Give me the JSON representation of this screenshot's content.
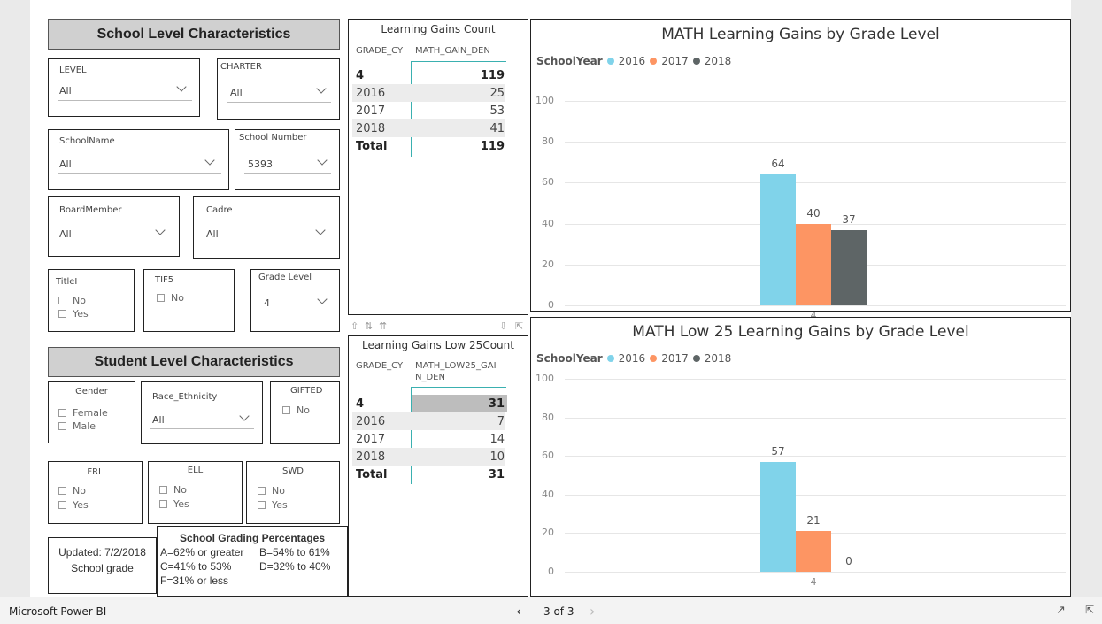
{
  "colors": {
    "y2016": "#80d3ea",
    "y2017": "#fd9563",
    "y2018": "#5e6566"
  },
  "school_header": "School Level Characteristics",
  "student_header": "Student Level Characteristics",
  "filters": {
    "level": {
      "label": "LEVEL",
      "value": "All"
    },
    "charter": {
      "label": "CHARTER",
      "value": "All"
    },
    "school_name": {
      "label": "SchoolName",
      "value": "All"
    },
    "school_number": {
      "label": "School Number",
      "value": "5393"
    },
    "board_member": {
      "label": "BoardMember",
      "value": "All"
    },
    "cadre": {
      "label": "Cadre",
      "value": "All"
    },
    "titlei": {
      "label": "TitleI",
      "options": [
        "No",
        "Yes"
      ]
    },
    "tif5": {
      "label": "TIF5",
      "options": [
        "No"
      ]
    },
    "grade_level": {
      "label": "Grade Level",
      "value": "4"
    },
    "gender": {
      "label": "Gender",
      "options": [
        "Female",
        "Male"
      ]
    },
    "race": {
      "label": "Race_Ethnicity",
      "value": "All"
    },
    "gifted": {
      "label": "GIFTED",
      "options": [
        "No"
      ]
    },
    "frl": {
      "label": "FRL",
      "options": [
        "No",
        "Yes"
      ]
    },
    "ell": {
      "label": "ELL",
      "options": [
        "No",
        "Yes"
      ]
    },
    "swd": {
      "label": "SWD",
      "options": [
        "No",
        "Yes"
      ]
    }
  },
  "updated": {
    "line1": "Updated: 7/2/2018",
    "line2": "School grade"
  },
  "grading": {
    "title": "School Grading Percentages",
    "a": "A=62% or greater",
    "b": "B=54% to 61%",
    "c": "C=41% to 53%",
    "d": "D=32% to 40%",
    "f": "F=31% or less"
  },
  "table1": {
    "title": "Learning Gains Count",
    "col1": "GRADE_CY",
    "col2": "MATH_GAIN_DEN",
    "rows": [
      {
        "k": "4",
        "v": "119"
      },
      {
        "k": "2016",
        "v": "25"
      },
      {
        "k": "2017",
        "v": "53"
      },
      {
        "k": "2018",
        "v": "41"
      },
      {
        "k": "Total",
        "v": "119"
      }
    ]
  },
  "table2": {
    "title": "Learning Gains Low 25Count",
    "col1": "GRADE_CY",
    "col2a": "MATH_LOW25_GAI",
    "col2b": "N_DEN",
    "rows": [
      {
        "k": "4",
        "v": "31"
      },
      {
        "k": "2016",
        "v": "7"
      },
      {
        "k": "2017",
        "v": "14"
      },
      {
        "k": "2018",
        "v": "10"
      },
      {
        "k": "Total",
        "v": "31"
      }
    ]
  },
  "chart_data": [
    {
      "type": "bar",
      "title": "MATH Learning Gains by Grade Level",
      "legend_title": "SchoolYear",
      "categories": [
        "4"
      ],
      "series": [
        {
          "name": "2016",
          "values": [
            64
          ]
        },
        {
          "name": "2017",
          "values": [
            40
          ]
        },
        {
          "name": "2018",
          "values": [
            37
          ]
        }
      ],
      "ylim": [
        0,
        100
      ],
      "yticks": [
        "100",
        "80",
        "60",
        "40",
        "20",
        "0"
      ],
      "grid": true,
      "legend_position": "top-left"
    },
    {
      "type": "bar",
      "title": "MATH Low 25 Learning Gains by Grade Level",
      "legend_title": "SchoolYear",
      "categories": [
        "4"
      ],
      "series": [
        {
          "name": "2016",
          "values": [
            57
          ]
        },
        {
          "name": "2017",
          "values": [
            21
          ]
        },
        {
          "name": "2018",
          "values": [
            0
          ]
        }
      ],
      "ylim": [
        0,
        100
      ],
      "yticks": [
        "100",
        "80",
        "60",
        "40",
        "20",
        "0"
      ],
      "grid": true,
      "legend_position": "top-left"
    }
  ],
  "footer": {
    "app": "Microsoft Power BI",
    "page": "3 of 3"
  }
}
